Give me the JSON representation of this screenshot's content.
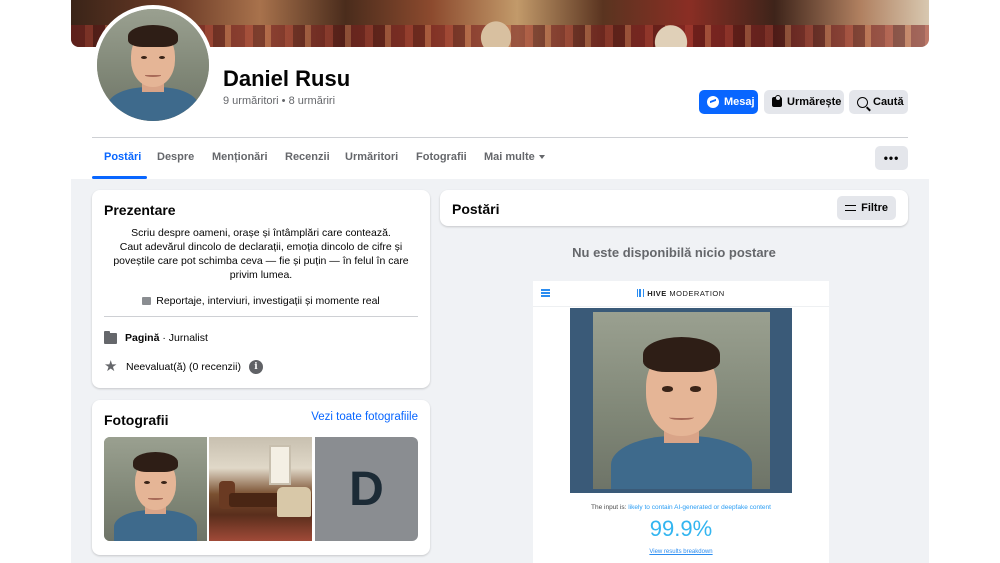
{
  "profile": {
    "name": "Daniel Rusu",
    "followers": "9 urmăritori • 8 urmăriri"
  },
  "actions": {
    "message": "Mesaj",
    "follow": "Urmărește",
    "search": "Caută",
    "more": "•••"
  },
  "tabs": [
    {
      "label": "Postări",
      "active": true
    },
    {
      "label": "Despre"
    },
    {
      "label": "Menționări"
    },
    {
      "label": "Recenzii"
    },
    {
      "label": "Urmăritori"
    },
    {
      "label": "Fotografii"
    },
    {
      "label": "Mai multe"
    }
  ],
  "intro": {
    "title": "Prezentare",
    "bio": [
      "Scriu despre oameni, orașe și întâmplări care contează.",
      "Caut adevărul dincolo de declarații, emoția dincolo de cifre și",
      "poveștile care pot schimba ceva — fie și puțin — în felul în care",
      "privim lumea."
    ],
    "tagline": "Reportaje, interviuri, investigații și momente real",
    "page_type": "Pagină",
    "page_category": " · Jurnalist",
    "rating": "Neevaluat(ă) (0 recenzii)",
    "info_icon": "i"
  },
  "photos": {
    "title": "Fotografii",
    "see_all": "Vezi toate fotografiile",
    "placeholder_letter": "D"
  },
  "posts": {
    "title": "Postări",
    "filter": "Filtre",
    "empty": "Nu este disponibilă nicio postare"
  },
  "hive": {
    "brand": "HIVE",
    "product": " MODERATION",
    "input_prefix": "The input is: ",
    "input_result": "likely to contain AI-generated or deepfake content",
    "score": "99.9%",
    "breakdown": "View results breakdown"
  },
  "colors": {
    "accent": "#0866ff",
    "hive_accent": "#33b5f0"
  }
}
